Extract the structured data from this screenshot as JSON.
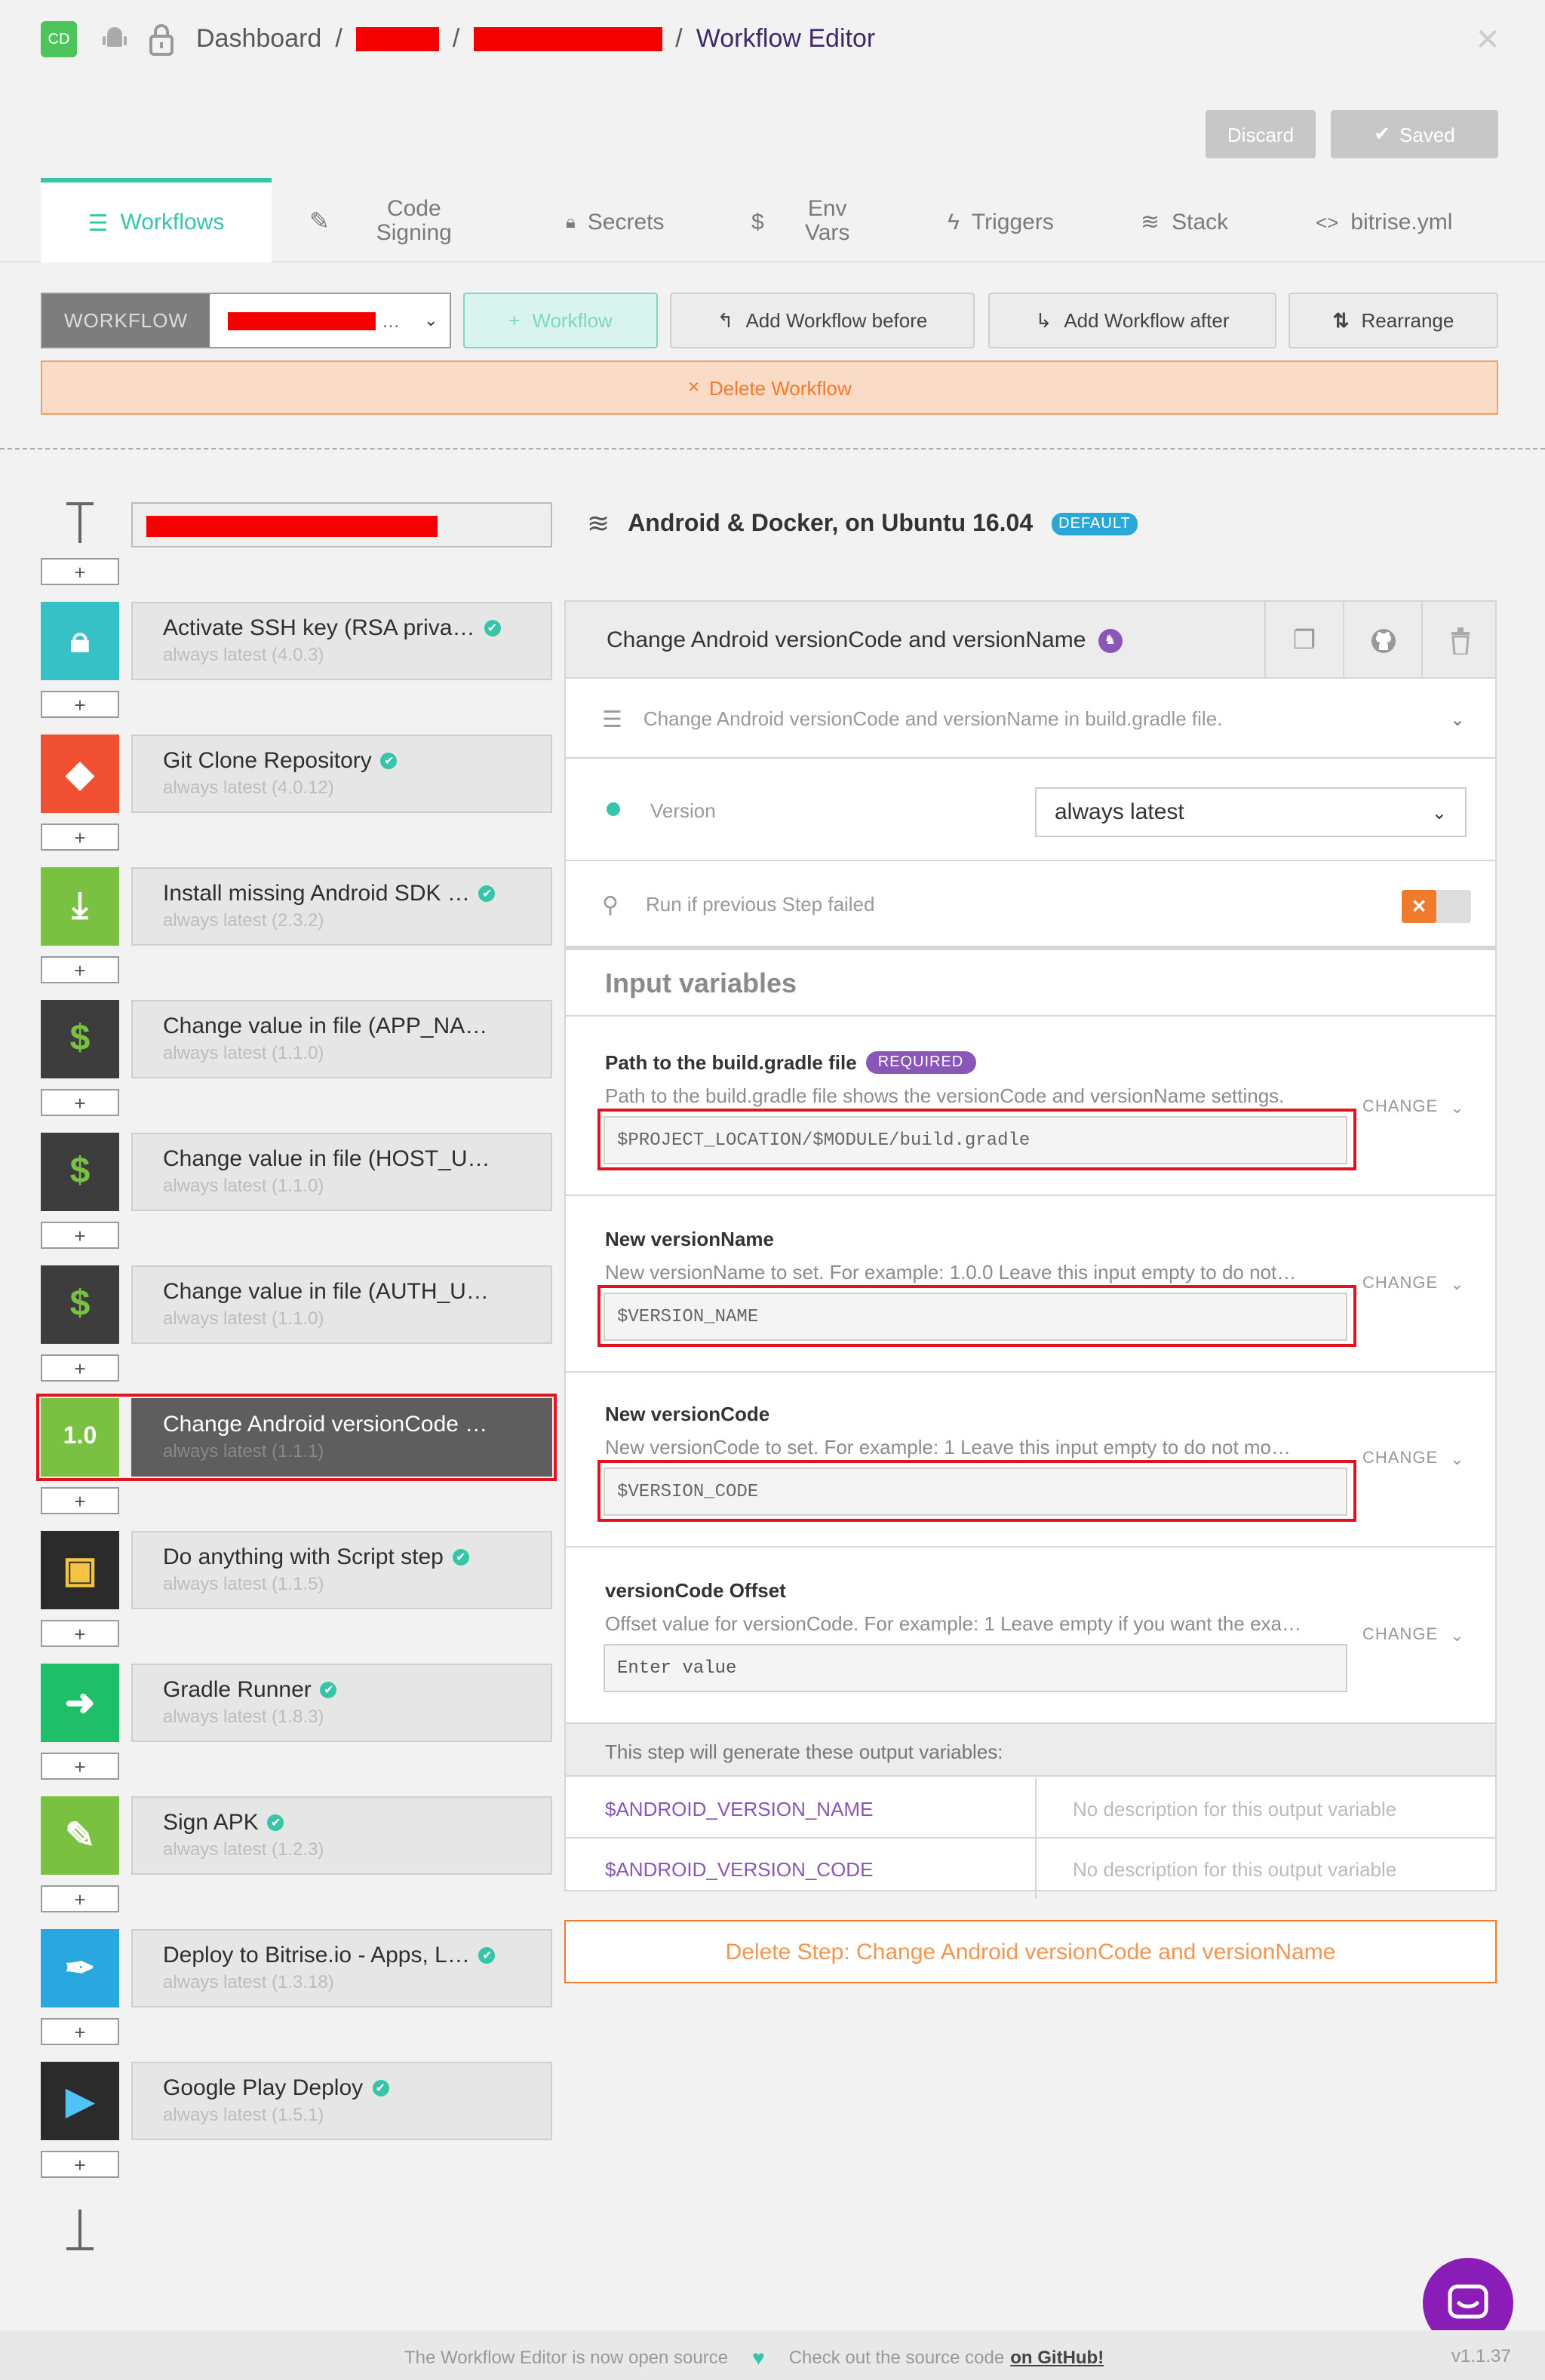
{
  "header": {
    "avatar": "CD",
    "crumb_dashboard": "Dashboard",
    "sep": "/",
    "crumb_page": "Workflow Editor",
    "discard": "Discard",
    "saved": "Saved"
  },
  "tabs": [
    {
      "label": "Workflows"
    },
    {
      "label": "Code\nSigning"
    },
    {
      "label": "Secrets"
    },
    {
      "label": "Env\nVars"
    },
    {
      "label": "Triggers"
    },
    {
      "label": "Stack"
    },
    {
      "label": "bitrise.yml"
    }
  ],
  "toolbar": {
    "workflow_label": "WORKFLOW",
    "add_workflow": "Workflow",
    "add_before": "Add Workflow before",
    "add_after": "Add Workflow after",
    "rearrange": "Rearrange",
    "delete_workflow": "Delete Workflow"
  },
  "stack": {
    "name": "Android & Docker, on Ubuntu 16.04",
    "badge": "DEFAULT"
  },
  "steps": [
    {
      "name": "Activate SSH key (RSA priva…",
      "version": "always latest (4.0.3)",
      "verified": true,
      "icon": "lock-icon",
      "color": "#35c1c5"
    },
    {
      "name": "Git Clone Repository",
      "version": "always latest (4.0.12)",
      "verified": true,
      "icon": "git-icon",
      "color": "#f05133"
    },
    {
      "name": "Install missing Android SDK …",
      "version": "always latest (2.3.2)",
      "verified": true,
      "icon": "android-download-icon",
      "color": "#7ac142"
    },
    {
      "name": "Change value in file (APP_NA…",
      "version": "always latest (1.1.0)",
      "verified": false,
      "icon": "dollar-icon",
      "color": "#3d3d3d"
    },
    {
      "name": "Change value in file (HOST_U…",
      "version": "always latest (1.1.0)",
      "verified": false,
      "icon": "dollar-icon",
      "color": "#3d3d3d"
    },
    {
      "name": "Change value in file (AUTH_U…",
      "version": "always latest (1.1.0)",
      "verified": false,
      "icon": "dollar-icon",
      "color": "#3d3d3d"
    },
    {
      "name": "Change Android versionCode …",
      "version": "always latest (1.1.1)",
      "verified": false,
      "icon": "version-icon",
      "color": "#7ac142",
      "selected": true
    },
    {
      "name": "Do anything with Script step",
      "version": "always latest (1.1.5)",
      "verified": true,
      "icon": "script-icon",
      "color": "#2b2b2b"
    },
    {
      "name": "Gradle Runner",
      "version": "always latest (1.8.3)",
      "verified": true,
      "icon": "gradle-icon",
      "color": "#1fbf6a"
    },
    {
      "name": "Sign APK",
      "version": "always latest (1.2.3)",
      "verified": true,
      "icon": "sign-apk-icon",
      "color": "#7ac142"
    },
    {
      "name": "Deploy to Bitrise.io - Apps, L…",
      "version": "always latest (1.3.18)",
      "verified": true,
      "icon": "feather-icon",
      "color": "#29a8e0"
    },
    {
      "name": "Google Play Deploy",
      "version": "always latest (1.5.1)",
      "verified": true,
      "icon": "play-icon",
      "color": "#2b2b2b"
    }
  ],
  "detail": {
    "title": "Change Android versionCode and versionName",
    "summary": "Change Android versionCode and versionName in build.gradle file.",
    "version_label": "Version",
    "version_value": "always latest",
    "run_if_failed": "Run if previous Step failed",
    "inputs_title": "Input variables",
    "change": "CHANGE",
    "inputs": [
      {
        "title": "Path to the build.gradle file",
        "required": "REQUIRED",
        "desc": "Path to the build.gradle file shows the versionCode and versionName settings.",
        "value": "$PROJECT_LOCATION/$MODULE/build.gradle"
      },
      {
        "title": "New versionName",
        "desc": "New versionName to set. For example: 1.0.0 Leave this input empty to do not…",
        "value": "$VERSION_NAME"
      },
      {
        "title": "New versionCode",
        "desc": "New versionCode to set. For example: 1 Leave this input empty to do not mo…",
        "value": "$VERSION_CODE"
      },
      {
        "title": "versionCode Offset",
        "desc": "Offset value for versionCode. For example: 1 Leave empty if you want the exa…",
        "placeholder": "Enter value"
      }
    ],
    "outputs_title": "This step will generate these output variables:",
    "outputs": [
      {
        "name": "$ANDROID_VERSION_NAME",
        "desc": "No description for this output variable"
      },
      {
        "name": "$ANDROID_VERSION_CODE",
        "desc": "No description for this output variable"
      }
    ],
    "delete_step": "Delete Step: Change Android versionCode and versionName"
  },
  "footer": {
    "text1": "The Workflow Editor is now open source",
    "text2": "Check out the source code",
    "link": "on GitHub!",
    "version": "v1.1.37"
  },
  "colors": {
    "accent": "#36c5a8",
    "purple": "#8a56b8",
    "orange": "#f07b2d",
    "redact": "#f40000"
  }
}
